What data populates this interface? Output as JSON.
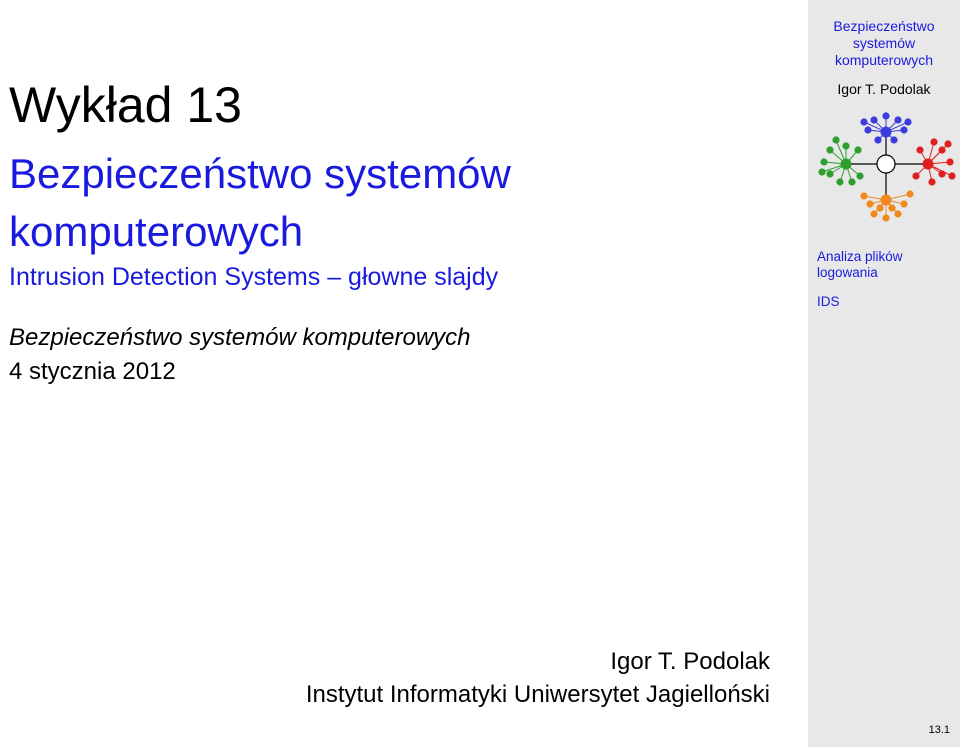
{
  "title": {
    "lecture": "Wykład 13",
    "line1": "Bezpieczeństwo systemów",
    "line2": "komputerowych",
    "subtitle": "Intrusion Detection Systems – głowne slajdy"
  },
  "course": "Bezpieczeństwo systemów komputerowych",
  "date": "4 stycznia 2012",
  "author": {
    "name": "Igor T. Podolak",
    "institute": "Instytut Informatyki Uniwersytet Jagielloński"
  },
  "sidebar": {
    "title_line1": "Bezpieczeństwo",
    "title_line2": "systemów",
    "title_line3": "komputerowych",
    "author": "Igor T. Podolak",
    "nav": [
      "Analiza plików logowania",
      "IDS"
    ],
    "graph_colors": {
      "blue": "#3b3be0",
      "green": "#2e9e2e",
      "red": "#e02020",
      "orange": "#f0891e",
      "hub": "#000000"
    }
  },
  "slide_number": "13.1"
}
